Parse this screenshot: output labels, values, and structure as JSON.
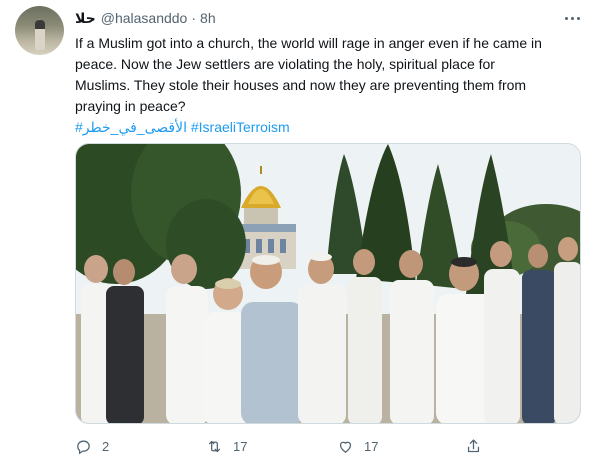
{
  "tweet": {
    "display_name": "حلا",
    "handle": "@halasanddo",
    "separator": "·",
    "time": "8h",
    "text_lines": [
      "If a Muslim got into a church, the world will rage in anger even if he came in",
      "peace. Now the Jew settlers are violating the holy, spiritual place for",
      "Muslims. They stole their houses and now they are preventing them from",
      "praying in peace?"
    ],
    "hashtags": [
      "#الأقصى_في_خطر",
      "#IsraeliTerroism"
    ]
  },
  "actions": {
    "reply_count": "2",
    "retweet_count": "17",
    "like_count": "17"
  },
  "icons": {
    "reply": "reply-icon",
    "retweet": "retweet-icon",
    "like": "heart-icon",
    "share": "share-icon",
    "more": "more-icon"
  },
  "colors": {
    "link": "#1d9bf0",
    "muted": "#536471",
    "text": "#0f1419"
  }
}
